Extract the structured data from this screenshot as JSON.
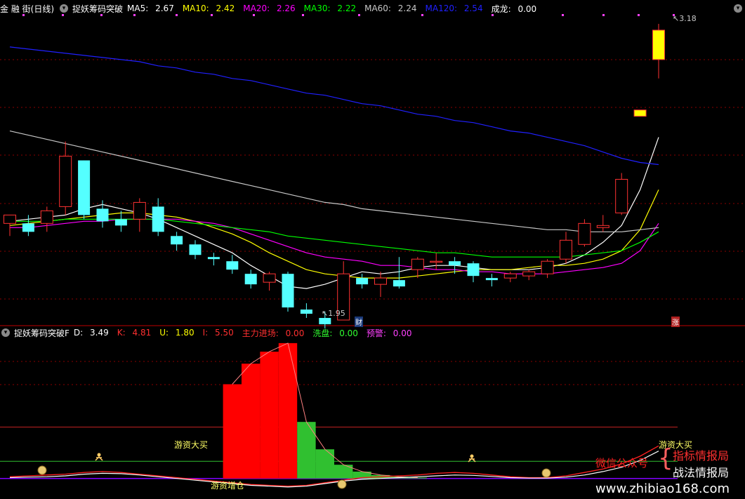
{
  "top_header": {
    "stock": "金 融 街",
    "period": "(日线)",
    "indicator": "捉妖筹码突破",
    "ma": [
      {
        "label": "MA5:",
        "value": "2.67",
        "color": "#ffffff"
      },
      {
        "label": "MA10:",
        "value": "2.42",
        "color": "#ffff00"
      },
      {
        "label": "MA20:",
        "value": "2.26",
        "color": "#ff00ff"
      },
      {
        "label": "MA30:",
        "value": "2.22",
        "color": "#00ff00"
      },
      {
        "label": "MA60:",
        "value": "2.24",
        "color": "#c8c8c8"
      },
      {
        "label": "MA120:",
        "value": "2.54",
        "color": "#2020ff"
      }
    ],
    "dragon_label": "成龙:",
    "dragon_value": "0.00"
  },
  "price_annotations": {
    "high": "3.18",
    "low": "1.95",
    "badge_cai": "财",
    "badge_zhang": "涨"
  },
  "bottom_header": {
    "indicator": "捉妖筹码突破F",
    "values": [
      {
        "label": "D:",
        "value": "3.49",
        "color": "#ffffff"
      },
      {
        "label": "K:",
        "value": "4.81",
        "color": "#ff3030"
      },
      {
        "label": "U:",
        "value": "1.80",
        "color": "#ffff00"
      },
      {
        "label": "I:",
        "value": "5.50",
        "color": "#ff3030"
      },
      {
        "label": "主力进场:",
        "value": "0.00",
        "color": "#ff3030"
      },
      {
        "label": "洗盘:",
        "value": "0.00",
        "color": "#30ff30"
      },
      {
        "label": "预警:",
        "value": "0.00",
        "color": "#ff40ff"
      }
    ]
  },
  "indicator_labels": {
    "buy1": "游资大买",
    "buy2": "游资大买",
    "add": "游资增仓"
  },
  "watermark": {
    "wechat": "微信公众号",
    "brand1": "指标情报局",
    "brand2": "战法情报局",
    "url": "www.zhibiao168.com"
  },
  "colors": {
    "up": "#ff3232",
    "down": "#54ffff",
    "limit_up": "#ffff00",
    "grid": "#8b0000"
  },
  "chart_data": {
    "type": "candlestick",
    "title": "",
    "candles": [
      {
        "o": 2.26,
        "h": 2.3,
        "l": 2.2,
        "c": 2.3
      },
      {
        "o": 2.26,
        "h": 2.3,
        "l": 2.2,
        "c": 2.22
      },
      {
        "o": 2.26,
        "h": 2.34,
        "l": 2.22,
        "c": 2.32
      },
      {
        "o": 2.34,
        "h": 2.65,
        "l": 2.3,
        "c": 2.58
      },
      {
        "o": 2.56,
        "h": 2.47,
        "l": 2.28,
        "c": 2.3
      },
      {
        "o": 2.33,
        "h": 2.37,
        "l": 2.24,
        "c": 2.27
      },
      {
        "o": 2.28,
        "h": 2.32,
        "l": 2.22,
        "c": 2.25
      },
      {
        "o": 2.28,
        "h": 2.38,
        "l": 2.22,
        "c": 2.36
      },
      {
        "o": 2.34,
        "h": 2.38,
        "l": 2.2,
        "c": 2.22
      },
      {
        "o": 2.2,
        "h": 2.22,
        "l": 2.13,
        "c": 2.16
      },
      {
        "o": 2.16,
        "h": 2.18,
        "l": 2.09,
        "c": 2.11
      },
      {
        "o": 2.1,
        "h": 2.12,
        "l": 2.06,
        "c": 2.09
      },
      {
        "o": 2.08,
        "h": 2.11,
        "l": 2.02,
        "c": 2.04
      },
      {
        "o": 2.02,
        "h": 2.04,
        "l": 1.95,
        "c": 1.97
      },
      {
        "o": 1.98,
        "h": 2.03,
        "l": 1.94,
        "c": 2.02
      },
      {
        "o": 2.02,
        "h": 2.03,
        "l": 1.84,
        "c": 1.86
      },
      {
        "o": 1.85,
        "h": 1.88,
        "l": 1.81,
        "c": 1.83
      },
      {
        "o": 1.81,
        "h": 1.84,
        "l": 1.76,
        "c": 1.78
      },
      {
        "o": 1.8,
        "h": 2.08,
        "l": 1.85,
        "c": 2.02
      },
      {
        "o": 2.0,
        "h": 2.02,
        "l": 1.95,
        "c": 1.97
      },
      {
        "o": 1.97,
        "h": 2.03,
        "l": 1.91,
        "c": 2.0
      },
      {
        "o": 1.99,
        "h": 2.1,
        "l": 1.95,
        "c": 1.96
      },
      {
        "o": 2.04,
        "h": 2.1,
        "l": 2.0,
        "c": 2.09
      },
      {
        "o": 2.08,
        "h": 2.12,
        "l": 2.04,
        "c": 2.08
      },
      {
        "o": 2.08,
        "h": 2.1,
        "l": 2.02,
        "c": 2.06
      },
      {
        "o": 2.07,
        "h": 2.08,
        "l": 1.98,
        "c": 2.01
      },
      {
        "o": 2.0,
        "h": 2.02,
        "l": 1.96,
        "c": 1.99
      },
      {
        "o": 2.0,
        "h": 2.03,
        "l": 1.98,
        "c": 2.02
      },
      {
        "o": 2.01,
        "h": 2.04,
        "l": 1.99,
        "c": 2.03
      },
      {
        "o": 2.02,
        "h": 2.09,
        "l": 2.0,
        "c": 2.08
      },
      {
        "o": 2.09,
        "h": 2.22,
        "l": 2.07,
        "c": 2.18
      },
      {
        "o": 2.16,
        "h": 2.28,
        "l": 2.15,
        "c": 2.26
      },
      {
        "o": 2.24,
        "h": 2.3,
        "l": 2.22,
        "c": 2.25
      },
      {
        "o": 2.31,
        "h": 2.5,
        "l": 2.3,
        "c": 2.47
      },
      {
        "o": 2.77,
        "h": 2.8,
        "l": 2.77,
        "c": 2.8
      },
      {
        "o": 3.04,
        "h": 3.21,
        "l": 2.95,
        "c": 3.18
      }
    ],
    "series": [
      {
        "name": "MA5",
        "values": [
          2.27,
          2.28,
          2.29,
          2.3,
          2.33,
          2.35,
          2.33,
          2.31,
          2.28,
          2.24,
          2.2,
          2.16,
          2.12,
          2.06,
          2.01,
          1.96,
          1.95,
          1.97,
          2.0,
          2.03,
          2.02,
          2.03,
          2.05,
          2.06,
          2.06,
          2.05,
          2.04,
          2.04,
          2.04,
          2.05,
          2.07,
          2.11,
          2.17,
          2.25,
          2.42,
          2.67
        ]
      },
      {
        "name": "MA10",
        "values": [
          2.25,
          2.26,
          2.27,
          2.28,
          2.29,
          2.3,
          2.31,
          2.31,
          2.3,
          2.29,
          2.27,
          2.24,
          2.21,
          2.17,
          2.12,
          2.08,
          2.04,
          2.02,
          2.01,
          2.0,
          2.0,
          2.0,
          2.01,
          2.02,
          2.03,
          2.04,
          2.04,
          2.04,
          2.05,
          2.06,
          2.06,
          2.07,
          2.09,
          2.13,
          2.23,
          2.42
        ]
      },
      {
        "name": "MA20",
        "values": [
          2.24,
          2.24,
          2.25,
          2.26,
          2.27,
          2.27,
          2.28,
          2.28,
          2.28,
          2.28,
          2.27,
          2.26,
          2.24,
          2.21,
          2.18,
          2.15,
          2.12,
          2.1,
          2.09,
          2.08,
          2.06,
          2.06,
          2.05,
          2.04,
          2.04,
          2.03,
          2.03,
          2.02,
          2.02,
          2.02,
          2.03,
          2.04,
          2.05,
          2.07,
          2.13,
          2.26
        ]
      },
      {
        "name": "MA30",
        "values": [
          2.27,
          2.27,
          2.27,
          2.28,
          2.28,
          2.28,
          2.28,
          2.28,
          2.28,
          2.27,
          2.26,
          2.25,
          2.24,
          2.23,
          2.22,
          2.2,
          2.19,
          2.18,
          2.17,
          2.16,
          2.15,
          2.14,
          2.13,
          2.12,
          2.12,
          2.11,
          2.1,
          2.1,
          2.1,
          2.1,
          2.1,
          2.11,
          2.12,
          2.13,
          2.17,
          2.22
        ]
      },
      {
        "name": "MA60",
        "values": [
          2.7,
          2.68,
          2.66,
          2.64,
          2.62,
          2.6,
          2.58,
          2.56,
          2.54,
          2.52,
          2.5,
          2.48,
          2.46,
          2.44,
          2.42,
          2.4,
          2.38,
          2.36,
          2.35,
          2.33,
          2.32,
          2.31,
          2.3,
          2.29,
          2.28,
          2.27,
          2.26,
          2.25,
          2.24,
          2.23,
          2.23,
          2.22,
          2.22,
          2.22,
          2.23,
          2.24
        ]
      },
      {
        "name": "MA120",
        "values": [
          3.1,
          3.09,
          3.08,
          3.07,
          3.06,
          3.05,
          3.04,
          3.03,
          3.01,
          3.0,
          2.98,
          2.97,
          2.95,
          2.94,
          2.92,
          2.9,
          2.88,
          2.87,
          2.85,
          2.83,
          2.82,
          2.8,
          2.78,
          2.77,
          2.75,
          2.74,
          2.72,
          2.7,
          2.69,
          2.67,
          2.65,
          2.63,
          2.6,
          2.57,
          2.55,
          2.54
        ]
      }
    ],
    "ylim": [
      1.78,
      3.25
    ],
    "indicator": {
      "bars": [
        0,
        0,
        0,
        0,
        0,
        0,
        0,
        0,
        0,
        0,
        0,
        0,
        5.5,
        6.7,
        7.4,
        7.9,
        3.3,
        1.7,
        0.8,
        0.4,
        0.2,
        0.1,
        0.05,
        0,
        0,
        0,
        0,
        0,
        0,
        0,
        0,
        0,
        0,
        0,
        0,
        0
      ],
      "bar_colors": [
        "red",
        "red",
        "red",
        "red",
        "red",
        "red",
        "red",
        "red",
        "red",
        "red",
        "red",
        "red",
        "red",
        "red",
        "red",
        "red",
        "green",
        "green",
        "green",
        "green",
        "green",
        "green",
        "green",
        "green",
        "green",
        "green",
        "green",
        "green",
        "green",
        "green",
        "green",
        "green",
        "green",
        "green",
        "green",
        "green"
      ],
      "line_red": [
        0.1,
        0.15,
        0.2,
        0.25,
        0.35,
        0.4,
        0.35,
        0.25,
        0.15,
        0.05,
        -0.05,
        -0.15,
        -0.25,
        -0.35,
        -0.4,
        -0.45,
        -0.4,
        -0.25,
        -0.1,
        0.05,
        0.1,
        0.15,
        0.2,
        0.3,
        0.35,
        0.3,
        0.2,
        0.1,
        0.05,
        0.05,
        0.15,
        0.35,
        0.55,
        0.85,
        1.3,
        1.9
      ],
      "line_white": [
        0.05,
        0.08,
        0.1,
        0.15,
        0.25,
        0.3,
        0.28,
        0.2,
        0.1,
        0.0,
        -0.1,
        -0.2,
        -0.3,
        -0.4,
        -0.45,
        -0.5,
        -0.45,
        -0.3,
        -0.15,
        -0.05,
        0.0,
        0.05,
        0.1,
        0.15,
        0.2,
        0.18,
        0.12,
        0.05,
        0.02,
        0.02,
        0.08,
        0.2,
        0.4,
        0.65,
        1.05,
        1.6
      ],
      "ylim": [
        -1.2,
        8.1
      ],
      "levels": [
        3.0,
        1.0
      ]
    }
  }
}
